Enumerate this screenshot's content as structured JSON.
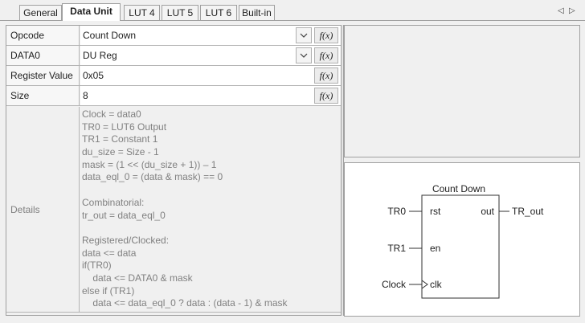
{
  "tabs": [
    {
      "label": "General",
      "active": false
    },
    {
      "label": "Data Unit",
      "active": true
    },
    {
      "label": "LUT 4",
      "active": false
    },
    {
      "label": "LUT 5",
      "active": false
    },
    {
      "label": "LUT 6",
      "active": false
    },
    {
      "label": "Built-in",
      "active": false
    }
  ],
  "nav": {
    "prev_icon": "◁",
    "next_icon": "▷"
  },
  "properties": {
    "opcode": {
      "label": "Opcode",
      "value": "Count Down",
      "fx": "f(x)"
    },
    "data0": {
      "label": "DATA0",
      "value": "DU Reg",
      "fx": "f(x)"
    },
    "register_value": {
      "label": "Register Value",
      "value": "0x05",
      "fx": "f(x)"
    },
    "size": {
      "label": "Size",
      "value": "8",
      "fx": "f(x)"
    }
  },
  "details": {
    "label": "Details",
    "lines": [
      "Clock = data0",
      "TR0 = LUT6 Output",
      "TR1 = Constant 1",
      "du_size = Size - 1",
      "mask = (1 << (du_size + 1)) – 1",
      "data_eql_0 = (data & mask) == 0",
      "",
      "Combinatorial:",
      "tr_out = data_eql_0",
      "",
      "Registered/Clocked:",
      "data <= data",
      "if(TR0)",
      "    data <= DATA0 & mask",
      "else if (TR1)",
      "    data <= data_eql_0 ? data : (data - 1) & mask"
    ]
  },
  "diagram": {
    "title": "Count Down",
    "inputs": [
      {
        "signal": "TR0",
        "port": "rst"
      },
      {
        "signal": "TR1",
        "port": "en"
      },
      {
        "signal": "Clock",
        "port": "clk"
      }
    ],
    "output": {
      "port": "out",
      "signal": "TR_out"
    }
  },
  "colors": {
    "accent_border": "#a0a0a0",
    "details_text": "#808080"
  }
}
